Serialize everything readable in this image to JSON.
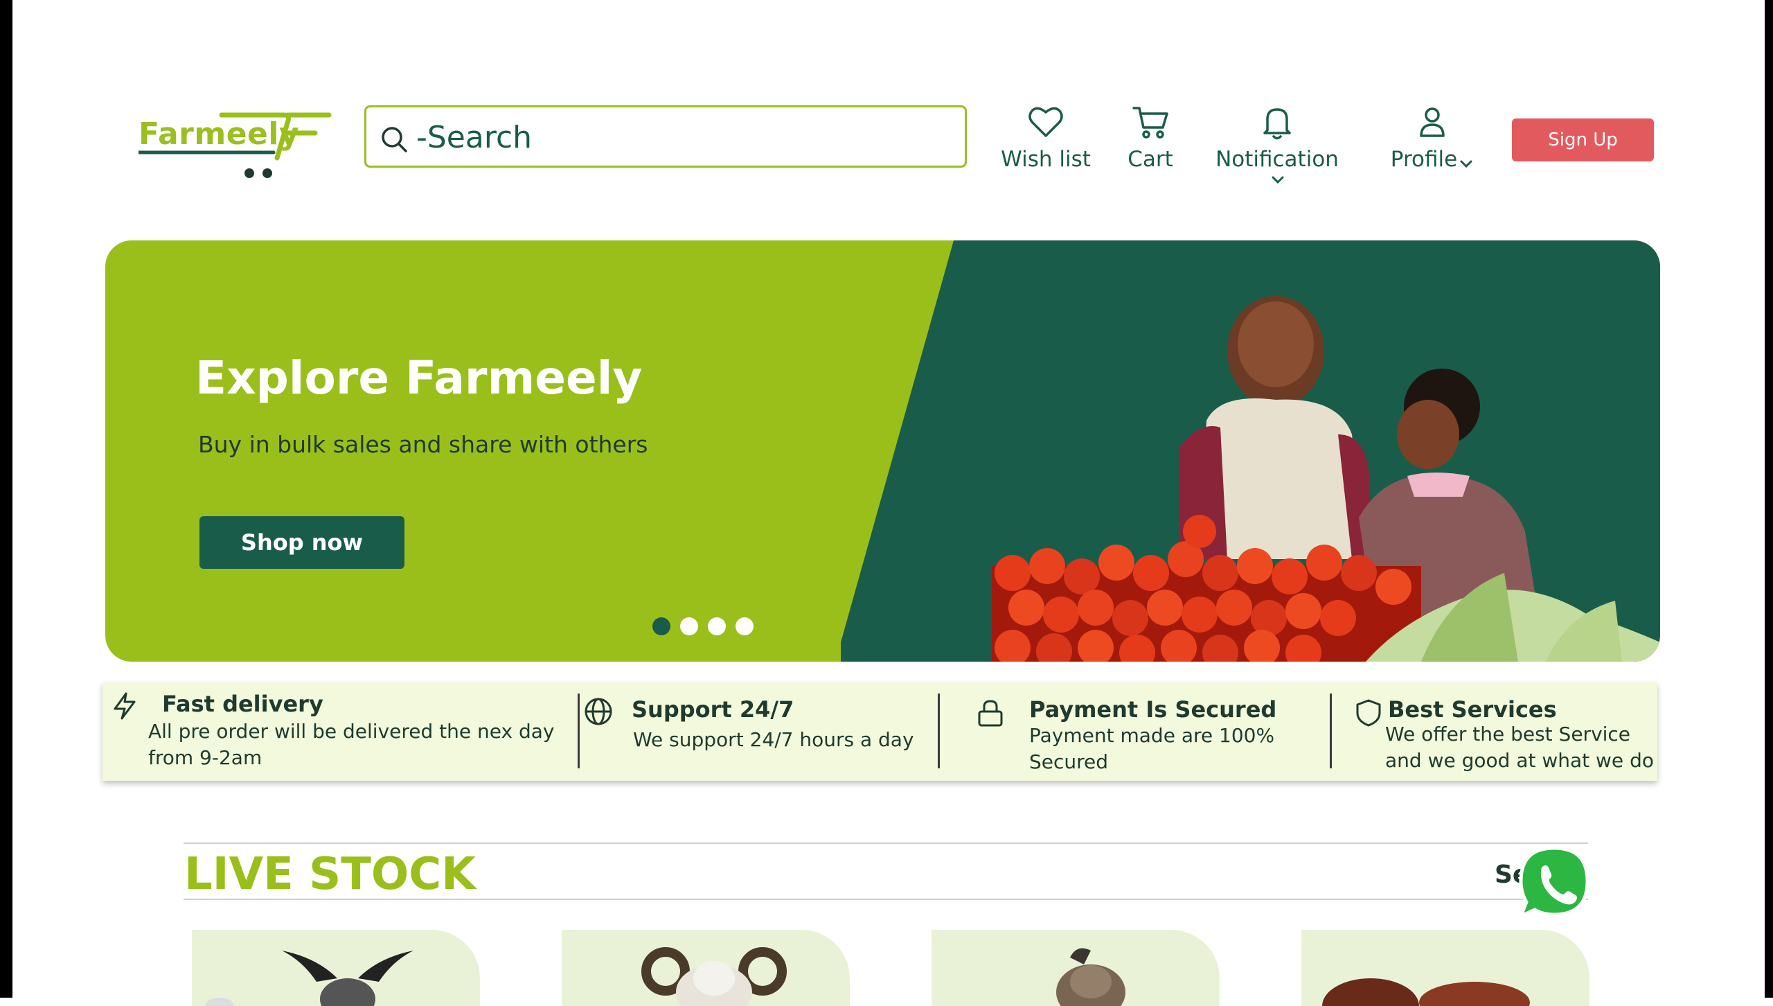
{
  "brand": {
    "name": "Farmeely",
    "accent": "#9abf1a",
    "primary": "#1a5c4a",
    "danger": "#e35a5e"
  },
  "search": {
    "placeholder": "-Search"
  },
  "nav": {
    "wishlist": "Wish list",
    "cart": "Cart",
    "notification": "Notification",
    "profile": "Profile",
    "signup": "Sign Up"
  },
  "hero": {
    "title": "Explore Farmeely",
    "subtitle": "Buy in bulk sales and share with others",
    "cta": "Shop now",
    "slides": 4,
    "active_slide": 1
  },
  "features": [
    {
      "icon": "lightning-icon",
      "title": "Fast delivery",
      "desc1": "All pre order will be delivered the nex day",
      "desc2": "from 9-2am"
    },
    {
      "icon": "globe-icon",
      "title": "Support 24/7",
      "desc1": "We support 24/7 hours a day",
      "desc2": ""
    },
    {
      "icon": "lock-icon",
      "title": "Payment Is Secured",
      "desc1": "Payment made are 100%",
      "desc2": "Secured"
    },
    {
      "icon": "shield-icon",
      "title": "Best Services",
      "desc1": "We offer the best Service",
      "desc2": "and we good at what we do"
    }
  ],
  "livestock": {
    "title": "LIVE STOCK",
    "see_all": "Se"
  }
}
